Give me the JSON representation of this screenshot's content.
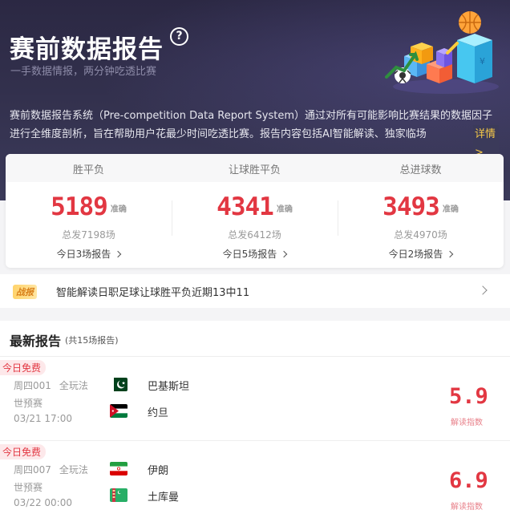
{
  "header": {
    "title": "赛前数据报告",
    "help_symbol": "?",
    "subtitle": "一手数据情报，两分钟吃透比赛",
    "description": "赛前数据报告系统（Pre-competition Data Report System）通过对所有可能影响比赛结果的数据因子进行全维度剖析，旨在帮助用户花最少时间吃透比赛。报告内容包括AI智能解读、独家临场",
    "more_link": "详情>"
  },
  "stats": [
    {
      "title": "胜平负",
      "value": "5189",
      "accurate_label": "准确",
      "total": "总发7198场",
      "today": "今日3场报告"
    },
    {
      "title": "让球胜平负",
      "value": "4341",
      "accurate_label": "准确",
      "total": "总发6412场",
      "today": "今日5场报告"
    },
    {
      "title": "总进球数",
      "value": "3493",
      "accurate_label": "准确",
      "total": "总发4970场",
      "today": "今日2场报告"
    }
  ],
  "news": {
    "tag": "战报",
    "text": "智能解读日职足球让球胜平负近期13中11"
  },
  "latest": {
    "title": "最新报告",
    "count": "(共15场报告)",
    "matches": [
      {
        "badge": "今日免费",
        "code": "周四001",
        "play": "全玩法",
        "league": "世预赛",
        "time": "03/21 17:00",
        "home": "巴基斯坦",
        "away": "约旦",
        "home_flag": "pakistan-flag-icon",
        "away_flag": "jordan-flag-icon",
        "score": "5.9",
        "score_label": "解读指数"
      },
      {
        "badge": "今日免费",
        "code": "周四007",
        "play": "全玩法",
        "league": "世预赛",
        "time": "03/22 00:00",
        "home": "伊朗",
        "away": "土库曼",
        "home_flag": "iran-flag-icon",
        "away_flag": "turkmenistan-flag-icon",
        "score": "6.9",
        "score_label": "解读指数"
      }
    ]
  },
  "colors": {
    "accent": "#e23742",
    "hero_bg": "#2f2d48",
    "link": "#f7c948"
  }
}
